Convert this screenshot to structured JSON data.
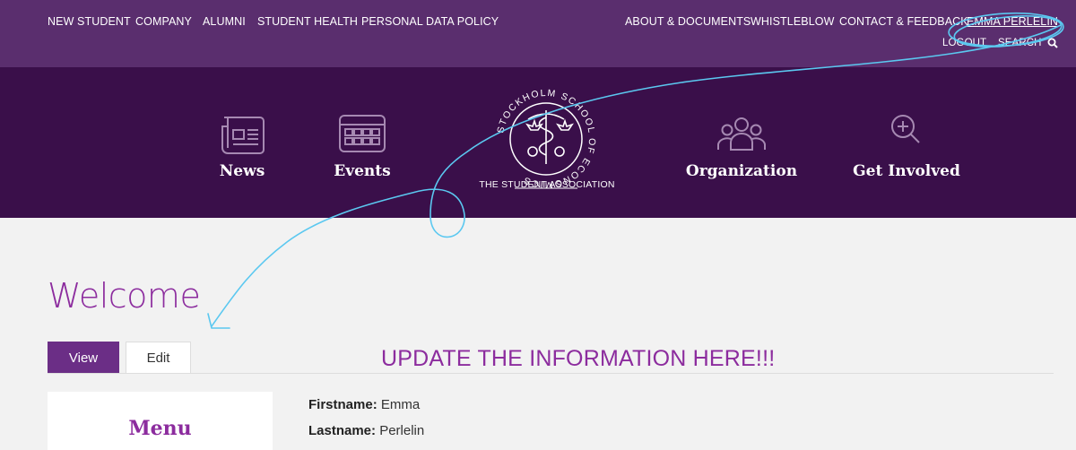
{
  "topnav": {
    "left": [
      "NEW STUDENT",
      "COMPANY",
      "ALUMNI",
      "STUDENT HEALTH",
      "PERSONAL DATA POLICY"
    ],
    "right": [
      "ABOUT & DOCUMENTS",
      "WHISTLEBLOW",
      "CONTACT & FEEDBACK"
    ],
    "user": "EMMA PERLELIN",
    "logout": "LOGOUT",
    "search": "SEARCH"
  },
  "brand": {
    "nav": [
      "News",
      "Events",
      "Organization",
      "Get Involved"
    ],
    "logo_text": "THE STUDENT ASSOCIATION",
    "logo_ring": "STOCKHOLM SCHOOL OF ECONOMICS"
  },
  "page": {
    "title": "Welcome",
    "tabs": [
      "View",
      "Edit"
    ],
    "notice": "UPDATE THE INFORMATION HERE!!!",
    "menu_title": "Menu",
    "fields": [
      {
        "label": "Firstname:",
        "value": "Emma"
      },
      {
        "label": "Lastname:",
        "value": "Perlelin"
      }
    ]
  },
  "colors": {
    "topbar": "#5a2e6e",
    "brand_band": "#3a0f4a",
    "accent_purple": "#8c2c9e",
    "annotation_blue": "#5bc8f0"
  }
}
